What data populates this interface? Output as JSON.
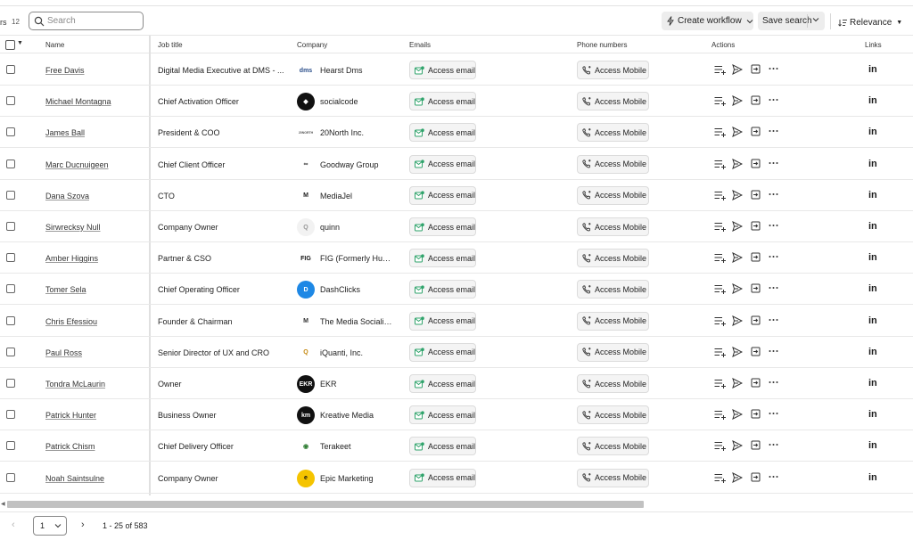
{
  "toolbar": {
    "filters_label": "rs",
    "filters_count": "12",
    "search_placeholder": "Search",
    "create_workflow": "Create workflow",
    "save_search": "Save search",
    "relevance": "Relevance"
  },
  "columns": {
    "name": "Name",
    "job_title": "Job title",
    "company": "Company",
    "emails": "Emails",
    "phone_numbers": "Phone numbers",
    "actions": "Actions",
    "links": "Links"
  },
  "buttons": {
    "access_email": "Access email",
    "access_mobile": "Access Mobile"
  },
  "rows": [
    {
      "name": "Free Davis",
      "job": "Digital Media Executive at DMS - ...",
      "company": "Hearst Dms",
      "logo_text": "dms",
      "logo_bg": "#ffffff",
      "logo_fg": "#2a4e8a"
    },
    {
      "name": "Michael Montagna",
      "job": "Chief Activation Officer",
      "company": "socialcode",
      "logo_text": "◆",
      "logo_bg": "#111111",
      "logo_fg": "#ffffff"
    },
    {
      "name": "James Ball",
      "job": "President & COO",
      "company": "20North Inc.",
      "logo_text": "20NORTH",
      "logo_bg": "#ffffff",
      "logo_fg": "#555555"
    },
    {
      "name": "Marc Ducnuigeen",
      "job": "Chief Client Officer",
      "company": "Goodway Group",
      "logo_text": "∞",
      "logo_bg": "#ffffff",
      "logo_fg": "#333333"
    },
    {
      "name": "Dana Szova",
      "job": "CTO",
      "company": "MediaJel",
      "logo_text": "M",
      "logo_bg": "#ffffff",
      "logo_fg": "#222222"
    },
    {
      "name": "Sirwrecksy Null",
      "job": "Company Owner",
      "company": "quinn",
      "logo_text": "Q",
      "logo_bg": "#f2f2f2",
      "logo_fg": "#999999"
    },
    {
      "name": "Amber Higgins",
      "job": "Partner & CSO",
      "company": "FIG (Formerly Hun...",
      "logo_text": "FIG",
      "logo_bg": "#ffffff",
      "logo_fg": "#111111"
    },
    {
      "name": "Tomer Sela",
      "job": "Chief Operating Officer",
      "company": "DashClicks",
      "logo_text": "D",
      "logo_bg": "#1e88e5",
      "logo_fg": "#ffffff"
    },
    {
      "name": "Chris Efessiou",
      "job": "Founder & Chairman",
      "company": "The Media Socialites",
      "logo_text": "M",
      "logo_bg": "#ffffff",
      "logo_fg": "#333333"
    },
    {
      "name": "Paul Ross",
      "job": "Senior Director of UX and CRO",
      "company": "iQuanti, Inc.",
      "logo_text": "Q",
      "logo_bg": "#ffffff",
      "logo_fg": "#c58a14"
    },
    {
      "name": "Tondra McLaurin",
      "job": "Owner",
      "company": "EKR",
      "logo_text": "EKR",
      "logo_bg": "#111111",
      "logo_fg": "#ffffff"
    },
    {
      "name": "Patrick Hunter",
      "job": "Business Owner",
      "company": "Kreative Media",
      "logo_text": "km",
      "logo_bg": "#111111",
      "logo_fg": "#ffffff"
    },
    {
      "name": "Patrick Chism",
      "job": "Chief Delivery Officer",
      "company": "Terakeet",
      "logo_text": "◉",
      "logo_bg": "#ffffff",
      "logo_fg": "#2e7d32"
    },
    {
      "name": "Noah Saintsulne",
      "job": "Company Owner",
      "company": "Epic Marketing",
      "logo_text": "e",
      "logo_bg": "#f5c400",
      "logo_fg": "#111111"
    }
  ],
  "pagination": {
    "page": "1",
    "range": "1 - 25 of 583"
  },
  "colors": {
    "accent_email": "#2fa36b"
  }
}
